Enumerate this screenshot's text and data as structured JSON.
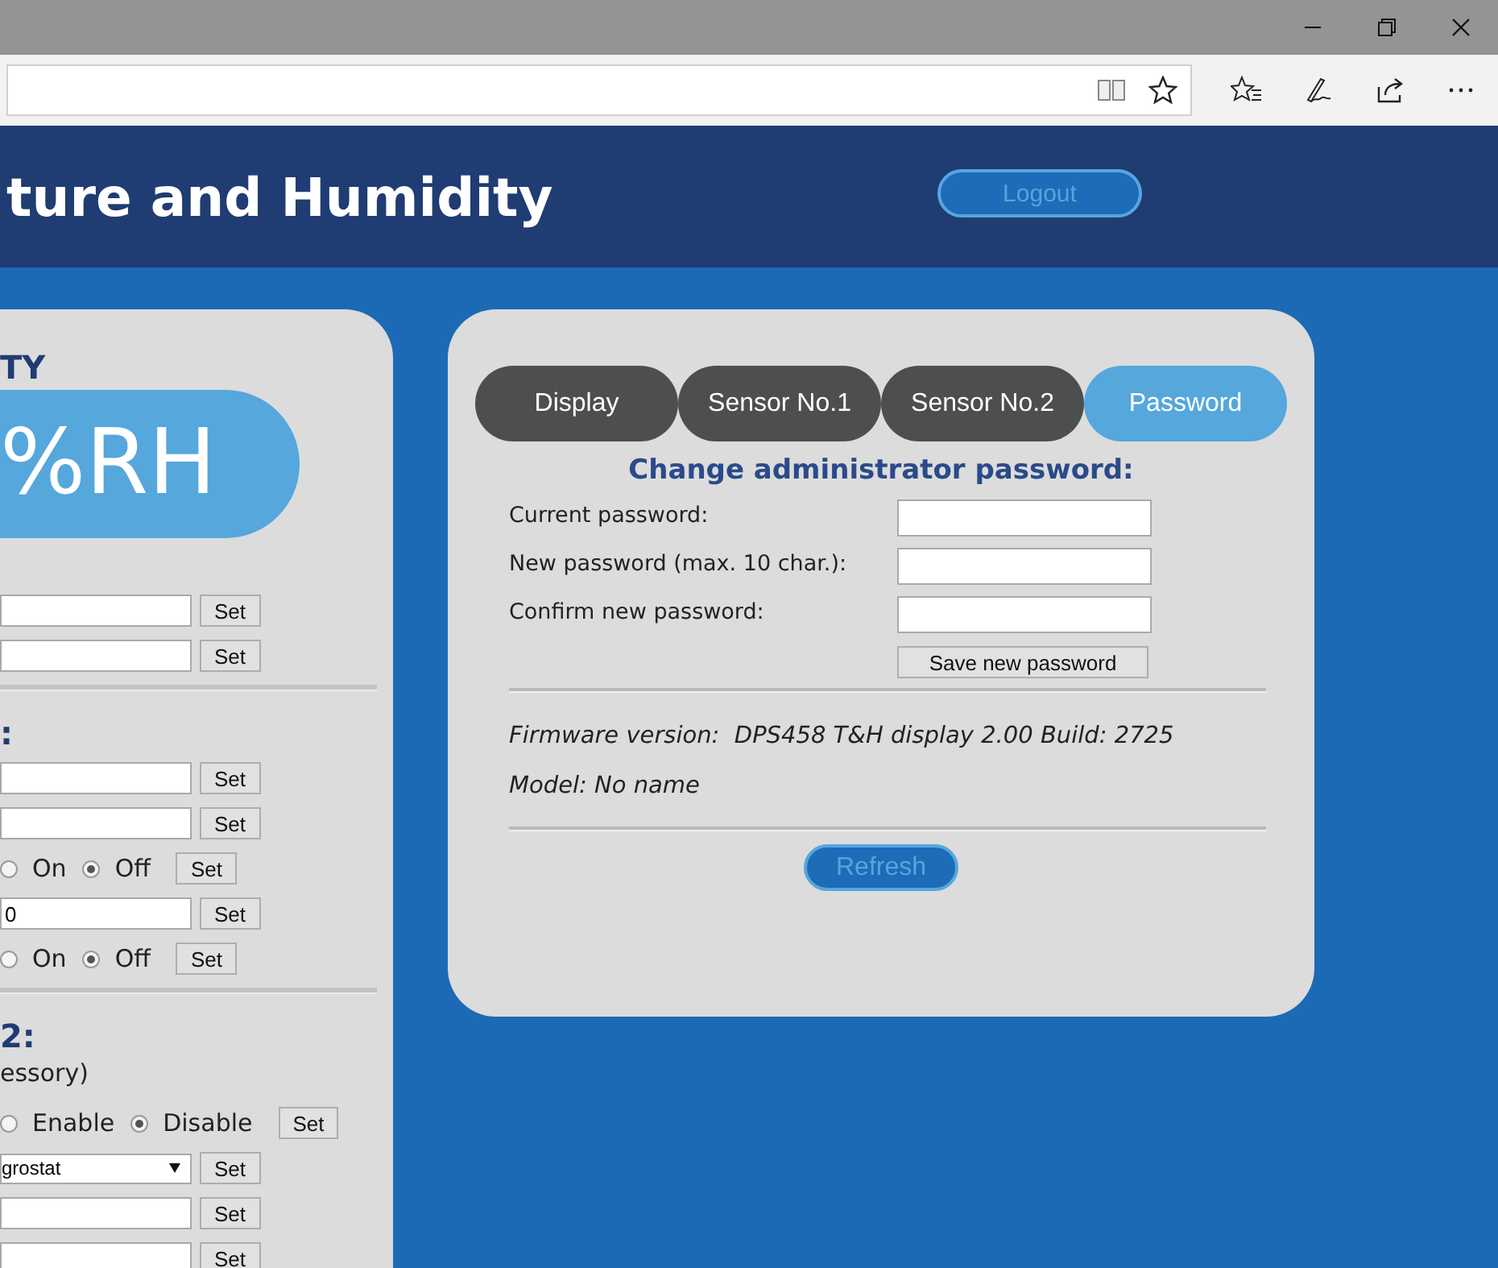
{
  "header": {
    "title": "ture and Humidity",
    "logout_button": "Logout"
  },
  "left_panel": {
    "items": [
      {
        "kind": "heading",
        "text": "TY"
      },
      {
        "kind": "reading",
        "text": "%RH"
      },
      {
        "kind": "field",
        "button": "Set"
      },
      {
        "kind": "field",
        "button": "Set"
      },
      {
        "kind": "divider"
      },
      {
        "kind": "heading",
        "text": ":"
      },
      {
        "kind": "field",
        "button": "Set"
      },
      {
        "kind": "field",
        "button": "Set"
      },
      {
        "kind": "radio",
        "options": [
          {
            "label": "On",
            "selected": false
          },
          {
            "label": "Off",
            "selected": true
          }
        ],
        "button": "Set"
      },
      {
        "kind": "field",
        "value": "0",
        "button": "Set"
      },
      {
        "kind": "radio",
        "options": [
          {
            "label": "On",
            "selected": false
          },
          {
            "label": "Off",
            "selected": true
          }
        ],
        "button": "Set"
      },
      {
        "kind": "divider"
      },
      {
        "kind": "heading",
        "text": "2:"
      },
      {
        "kind": "text",
        "text": "essory)"
      },
      {
        "kind": "radio",
        "options": [
          {
            "label": "Enable",
            "selected": false
          },
          {
            "label": "Disable",
            "selected": true
          }
        ],
        "button": "Set"
      },
      {
        "kind": "select",
        "value": "grostat",
        "button": "Set"
      },
      {
        "kind": "field",
        "button": "Set"
      },
      {
        "kind": "field",
        "button": "Set"
      }
    ]
  },
  "settings_panel": {
    "tabs": [
      {
        "label": "Display",
        "selected": false
      },
      {
        "label": "Sensor No.1",
        "selected": false
      },
      {
        "label": "Sensor No.2",
        "selected": false
      },
      {
        "label": "Password",
        "selected": true
      }
    ],
    "heading": "Change administrator password:",
    "fields": [
      {
        "label": "Current password:"
      },
      {
        "label": "New password (max. 10 char.):"
      },
      {
        "label": "Confirm new password:"
      }
    ],
    "save_button": "Save new password",
    "firmware": {
      "label": "Firmware version:",
      "value": "DPS458 T&H display 2.00 Build: 2725"
    },
    "model": "Model: No name",
    "refresh_button": "Refresh"
  }
}
